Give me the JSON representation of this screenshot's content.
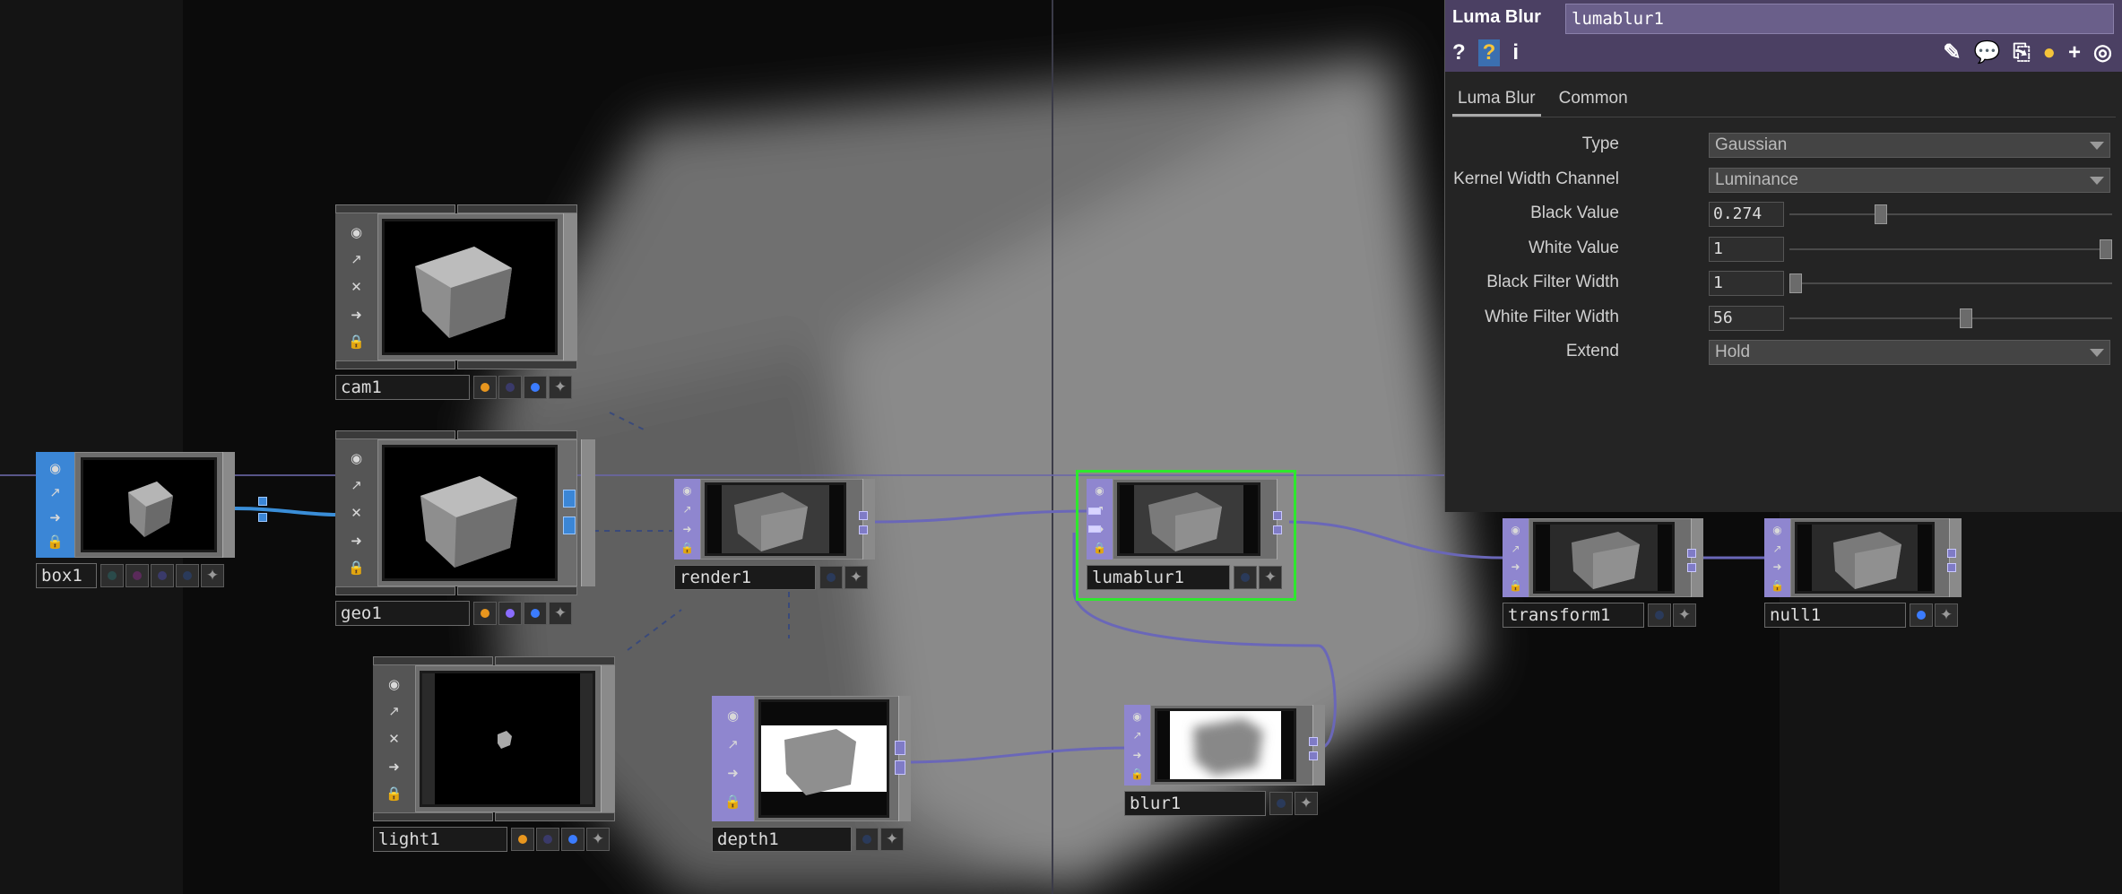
{
  "nodes": [
    {
      "id": "box1",
      "label": "box1",
      "flag_colors": [
        "#2a4a4a",
        "#5a2a5a",
        "#3a3a6a",
        "#2a3a5a"
      ]
    },
    {
      "id": "cam1",
      "label": "cam1",
      "flag_colors": [
        "#e8961e",
        "#3a3a6a",
        "#3b7cff"
      ]
    },
    {
      "id": "geo1",
      "label": "geo1",
      "flag_colors": [
        "#e8961e",
        "#8a6cff",
        "#3b7cff"
      ]
    },
    {
      "id": "light1",
      "label": "light1",
      "flag_colors": [
        "#e8961e",
        "#3a3a6a",
        "#3b7cff"
      ]
    },
    {
      "id": "render1",
      "label": "render1",
      "flag_colors": [
        "#2a3a5a"
      ]
    },
    {
      "id": "depth1",
      "label": "depth1",
      "flag_colors": [
        "#2a3a5a"
      ]
    },
    {
      "id": "lumablur1",
      "label": "lumablur1",
      "flag_colors": [
        "#2a3a5a"
      ]
    },
    {
      "id": "blur1",
      "label": "blur1",
      "flag_colors": [
        "#2a3a5a"
      ]
    },
    {
      "id": "transform1",
      "label": "transform1",
      "flag_colors": [
        "#2a3a5a"
      ]
    },
    {
      "id": "null1",
      "label": "null1",
      "flag_colors": [
        "#3b7cff"
      ]
    }
  ],
  "selected_node": "lumablur1",
  "panel": {
    "title": "Luma Blur",
    "node_name": "lumablur1",
    "header_left_icons": [
      {
        "name": "help-icon",
        "glyph": "?"
      },
      {
        "name": "python-help-icon",
        "glyph": "?"
      },
      {
        "name": "info-icon",
        "glyph": "i"
      }
    ],
    "header_right_icons": [
      {
        "name": "edit-icon",
        "glyph": "✎"
      },
      {
        "name": "comment-icon",
        "glyph": "💬"
      },
      {
        "name": "clone-icon",
        "glyph": "⎘"
      },
      {
        "name": "python-icon",
        "glyph": "●"
      },
      {
        "name": "add-icon",
        "glyph": "+"
      },
      {
        "name": "target-icon",
        "glyph": "◎"
      }
    ],
    "tabs": [
      {
        "label": "Luma Blur",
        "active": true
      },
      {
        "label": "Common",
        "active": false
      }
    ],
    "params": [
      {
        "label": "Type",
        "kind": "menu",
        "value": "Gaussian"
      },
      {
        "label": "Kernel Width Channel",
        "kind": "menu",
        "value": "Luminance"
      },
      {
        "label": "Black Value",
        "kind": "slider",
        "value": "0.274",
        "fraction": 0.274
      },
      {
        "label": "White Value",
        "kind": "slider",
        "value": "1",
        "fraction": 1.0
      },
      {
        "label": "Black Filter Width",
        "kind": "slider",
        "value": "1",
        "fraction": 0.0
      },
      {
        "label": "White Filter Width",
        "kind": "slider",
        "value": "56",
        "fraction": 0.55
      },
      {
        "label": "Extend",
        "kind": "menu",
        "value": "Hold"
      }
    ]
  },
  "colors": {
    "accent": "#4b4063",
    "wire": "#6a67b8",
    "selection": "#2ee82e",
    "comp_node": "#8f86cf",
    "sop_node": "#4a8fd8"
  }
}
